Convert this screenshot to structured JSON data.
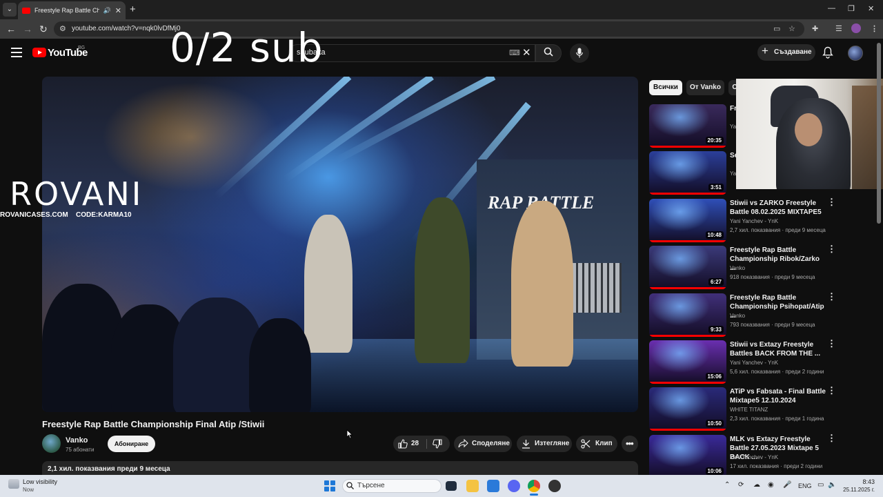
{
  "browser": {
    "tab_title": "Freestyle Rap Battle Champ",
    "url": "youtube.com/watch?v=nqk0lvDfMj0"
  },
  "youtube": {
    "logo_text": "YouTube",
    "region": "BG",
    "search_query": "shubaka",
    "create_label": "Създаване"
  },
  "overlay": {
    "sub_counter": "0/2 sub",
    "sponsor_logo": "ROVANI",
    "sponsor_site": "ROVANICASES.COM",
    "sponsor_code": "CODE:KARMA10"
  },
  "video": {
    "stage_text": "RAP BATTLE",
    "title": "Freestyle Rap Battle Championship Final Atip /Stiwii",
    "channel": "Vanko",
    "subscribers": "75 абонати",
    "subscribe_label": "Абониране",
    "likes": "28",
    "share_label": "Споделяне",
    "download_label": "Изтегляне",
    "clip_label": "Клип",
    "stats": "2,1 хил. показвания  преди 9 месеца"
  },
  "chips": [
    "Всички",
    "От Vanko",
    "С"
  ],
  "recommendations": [
    {
      "title": "Fr... Cl...",
      "channel": "Ya...",
      "stats": "",
      "duration": "20:35",
      "thumb_color": "#3a2a5c"
    },
    {
      "title": "Se... Mi...",
      "channel": "Ya...",
      "stats": "",
      "duration": "3:51",
      "thumb_color": "#2b3f9a"
    },
    {
      "title": "Stiwii vs ZARKO Freestyle Battle 08.02.2025 MIXTAPE5",
      "channel": "Yani Yanchev - YnK",
      "stats": "2,7 хил. показвания · преди 9 месеца",
      "duration": "10:48",
      "thumb_color": "#2f4fb8"
    },
    {
      "title": "Freestyle Rap Battle Championship Ribok/Zarko ...",
      "channel": "Vanko",
      "stats": "918 показвания · преди 9 месеца",
      "duration": "6:27",
      "thumb_color": "#3b3a7a"
    },
    {
      "title": "Freestyle Rap Battle Championship Psihopat/Atip ...",
      "channel": "Vanko",
      "stats": "793 показвания · преди 9 месеца",
      "duration": "9:33",
      "thumb_color": "#41307a"
    },
    {
      "title": "Stiwii vs Extazy Freestyle Battles BACK FROM THE ...",
      "channel": "Yani Yanchev - YnK",
      "stats": "5,6 хил. показвания · преди 2 години",
      "duration": "15:06",
      "thumb_color": "#6a2fb0"
    },
    {
      "title": "ATiP vs Fabsata - Final Battle Mixtape5 12.10.2024",
      "channel": "WHITE TITANZ",
      "stats": "2,3 хил. показвания · преди 1 година",
      "duration": "10:50",
      "thumb_color": "#2a2a7a"
    },
    {
      "title": "MLK vs Extazy Freestyle Battle 27.05.2023 Mixtape 5 BACK ...",
      "channel": "Yani Yanchev - YnK",
      "stats": "17 хил. показвания · преди 2 години",
      "duration": "10:06",
      "thumb_color": "#3a2a9a"
    }
  ],
  "taskbar": {
    "weather_title": "Low visibility",
    "weather_sub": "Now",
    "search_label": "Търсене",
    "lang": "ENG",
    "time": "8:43",
    "date": "25.11.2025 г."
  }
}
